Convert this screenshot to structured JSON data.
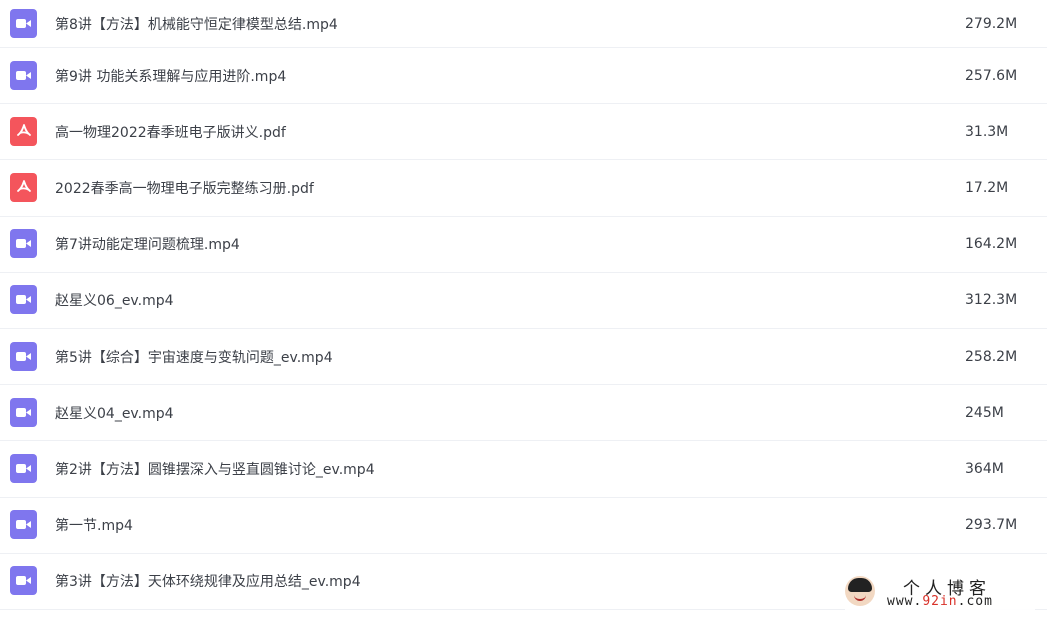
{
  "files": [
    {
      "icon": "video-file-icon",
      "type": "video",
      "name": "第8讲【方法】机械能守恒定律模型总结.mp4",
      "size": "279.2M"
    },
    {
      "icon": "video-file-icon",
      "type": "video",
      "name": "第9讲 功能关系理解与应用进阶.mp4",
      "size": "257.6M"
    },
    {
      "icon": "pdf-file-icon",
      "type": "pdf",
      "name": "高一物理2022春季班电子版讲义.pdf",
      "size": "31.3M"
    },
    {
      "icon": "pdf-file-icon",
      "type": "pdf",
      "name": "2022春季高一物理电子版完整练习册.pdf",
      "size": "17.2M"
    },
    {
      "icon": "video-file-icon",
      "type": "video",
      "name": "第7讲动能定理问题梳理.mp4",
      "size": "164.2M"
    },
    {
      "icon": "video-file-icon",
      "type": "video",
      "name": "赵星义06_ev.mp4",
      "size": "312.3M"
    },
    {
      "icon": "video-file-icon",
      "type": "video",
      "name": "第5讲【综合】宇宙速度与变轨问题_ev.mp4",
      "size": "258.2M"
    },
    {
      "icon": "video-file-icon",
      "type": "video",
      "name": "赵星义04_ev.mp4",
      "size": "245M"
    },
    {
      "icon": "video-file-icon",
      "type": "video",
      "name": "第2讲【方法】圆锥摆深入与竖直圆锥讨论_ev.mp4",
      "size": "364M"
    },
    {
      "icon": "video-file-icon",
      "type": "video",
      "name": "第一节.mp4",
      "size": "293.7M"
    },
    {
      "icon": "video-file-icon",
      "type": "video",
      "name": "第3讲【方法】天体环绕规律及应用总结_ev.mp4",
      "size": ""
    }
  ],
  "colors": {
    "video_icon": "#7f76ee",
    "pdf_icon": "#f4555c",
    "text": "#3c4048",
    "divider": "#eef0f4"
  },
  "watermark": {
    "title": "个人博客",
    "url_prefix": "www.",
    "url_highlight": "92in",
    "url_suffix": ".com"
  }
}
